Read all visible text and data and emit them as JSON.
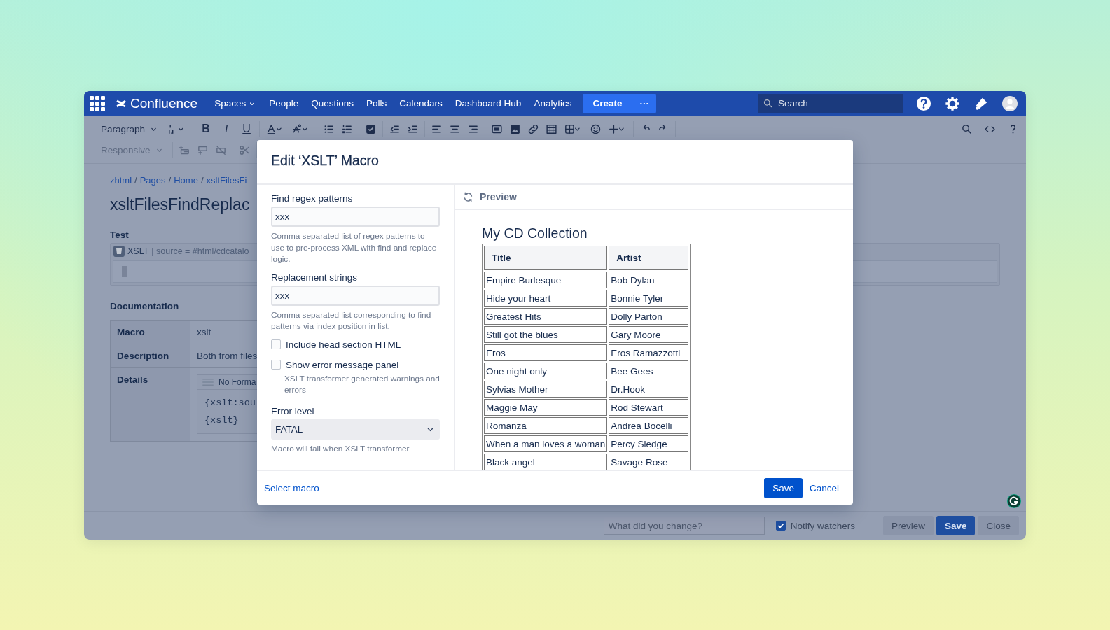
{
  "header": {
    "product": "Confluence",
    "nav": [
      {
        "label": "Spaces",
        "dropdown": true
      },
      {
        "label": "People",
        "dropdown": false
      },
      {
        "label": "Questions",
        "dropdown": false
      },
      {
        "label": "Polls",
        "dropdown": false
      },
      {
        "label": "Calendars",
        "dropdown": false
      },
      {
        "label": "Dashboard Hub",
        "dropdown": false
      },
      {
        "label": "Analytics",
        "dropdown": false
      }
    ],
    "create": "Create",
    "more": "···",
    "search": {
      "placeholder": "Search"
    }
  },
  "toolbar": {
    "paragraph": "Paragraph",
    "format": [
      "B",
      "I",
      "U"
    ],
    "responsive": "Responsive"
  },
  "page": {
    "breadcrumbs": [
      {
        "label": "zhtml",
        "sep": "/"
      },
      {
        "label": "Pages",
        "sep": "/"
      },
      {
        "label": "Home",
        "sep": "/"
      },
      {
        "label": "xsltFilesFi"
      }
    ],
    "title": "xsltFilesFindReplac",
    "section": "Test",
    "macro_placeholder": {
      "name": "XSLT",
      "params": "| source = #html/cdcatalo"
    },
    "documentation": {
      "heading": "Documentation",
      "rows": [
        {
          "label": "Macro",
          "value": "xslt"
        },
        {
          "label": "Description",
          "value": "Both from files"
        },
        {
          "label": "Details",
          "panel_title": "No Forma",
          "code": [
            "{xslt:sou",
            "{xslt}"
          ]
        }
      ]
    }
  },
  "modal": {
    "title": "Edit ‘XSLT’ Macro",
    "fields": [
      {
        "kind": "text",
        "label": "Find regex patterns",
        "value": "xxx",
        "help": "Comma separated list of regex patterns to use to pre-process XML with find and replace logic."
      },
      {
        "kind": "text",
        "label": "Replacement strings",
        "value": "xxx",
        "help": "Comma separated list corresponding to find patterns via index position in list."
      },
      {
        "kind": "checkbox",
        "label": "Include head section HTML",
        "checked": false
      },
      {
        "kind": "checkbox",
        "label": "Show error message panel",
        "checked": false,
        "help": "XSLT transformer generated warnings and errors"
      },
      {
        "kind": "select",
        "label": "Error level",
        "value": "FATAL",
        "help": "Macro will fail when XSLT transformer"
      }
    ],
    "preview": {
      "label": "Preview",
      "heading": "My CD Collection",
      "columns": [
        "Title",
        "Artist"
      ],
      "rows": [
        [
          "Empire Burlesque",
          "Bob Dylan"
        ],
        [
          "Hide your heart",
          "Bonnie Tyler"
        ],
        [
          "Greatest Hits",
          "Dolly Parton"
        ],
        [
          "Still got the blues",
          "Gary Moore"
        ],
        [
          "Eros",
          "Eros Ramazzotti"
        ],
        [
          "One night only",
          "Bee Gees"
        ],
        [
          "Sylvias Mother",
          "Dr.Hook"
        ],
        [
          "Maggie May",
          "Rod Stewart"
        ],
        [
          "Romanza",
          "Andrea Bocelli"
        ],
        [
          "When a man loves a woman",
          "Percy Sledge"
        ],
        [
          "Black angel",
          "Savage Rose"
        ]
      ]
    },
    "footer": {
      "link": "Select macro",
      "save": "Save",
      "cancel": "Cancel"
    }
  },
  "bottom_bar": {
    "change_note": {
      "placeholder": "What did you change?"
    },
    "notify": {
      "label": "Notify watchers",
      "checked": true
    },
    "buttons": [
      {
        "label": "Preview",
        "kind": "secondary"
      },
      {
        "label": "Save",
        "kind": "primary"
      },
      {
        "label": "Close",
        "kind": "secondary"
      }
    ]
  }
}
